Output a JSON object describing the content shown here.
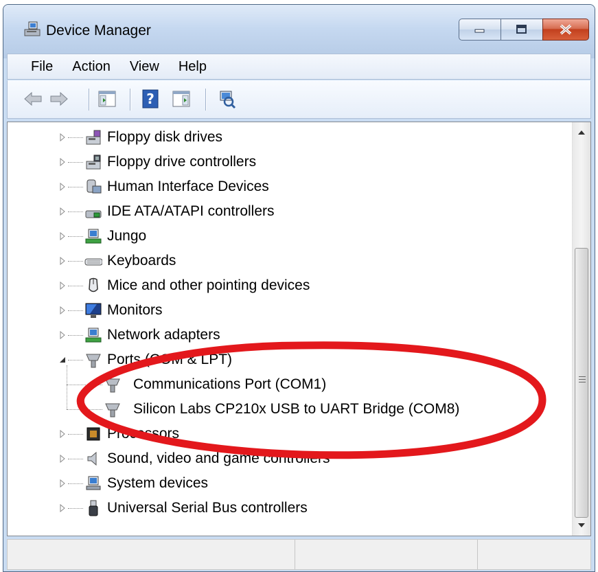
{
  "window": {
    "title": "Device Manager"
  },
  "menu": {
    "items": [
      "File",
      "Action",
      "View",
      "Help"
    ]
  },
  "toolbar": {
    "buttons": [
      "back-icon",
      "forward-icon",
      "show-hide-console-tree-icon",
      "help-icon",
      "action-pane-icon",
      "scan-hardware-icon"
    ]
  },
  "tree": {
    "items": [
      {
        "label": "Floppy disk drives",
        "icon": "floppy-disk-icon",
        "expanded": false
      },
      {
        "label": "Floppy drive controllers",
        "icon": "floppy-controller-icon",
        "expanded": false
      },
      {
        "label": "Human Interface Devices",
        "icon": "hid-icon",
        "expanded": false
      },
      {
        "label": "IDE ATA/ATAPI controllers",
        "icon": "ide-controller-icon",
        "expanded": false
      },
      {
        "label": "Jungo",
        "icon": "jungo-icon",
        "expanded": false
      },
      {
        "label": "Keyboards",
        "icon": "keyboard-icon",
        "expanded": false
      },
      {
        "label": "Mice and other pointing devices",
        "icon": "mouse-icon",
        "expanded": false
      },
      {
        "label": "Monitors",
        "icon": "monitor-icon",
        "expanded": false
      },
      {
        "label": "Network adapters",
        "icon": "network-adapter-icon",
        "expanded": false
      },
      {
        "label": "Ports (COM & LPT)",
        "icon": "port-icon",
        "expanded": true
      },
      {
        "label": "Communications Port (COM1)",
        "icon": "port-icon",
        "child": true
      },
      {
        "label": "Silicon Labs CP210x USB to UART Bridge (COM8)",
        "icon": "port-icon",
        "child": true
      },
      {
        "label": "Processors",
        "icon": "processor-icon",
        "expanded": false
      },
      {
        "label": "Sound, video and game controllers",
        "icon": "speaker-icon",
        "expanded": false
      },
      {
        "label": "System devices",
        "icon": "system-device-icon",
        "expanded": false
      },
      {
        "label": "Universal Serial Bus controllers",
        "icon": "usb-icon",
        "expanded": false
      }
    ]
  },
  "colors": {
    "annotation": "#e3181c",
    "titlebar": "#c5d8f0",
    "close_button": "#c2401e"
  }
}
